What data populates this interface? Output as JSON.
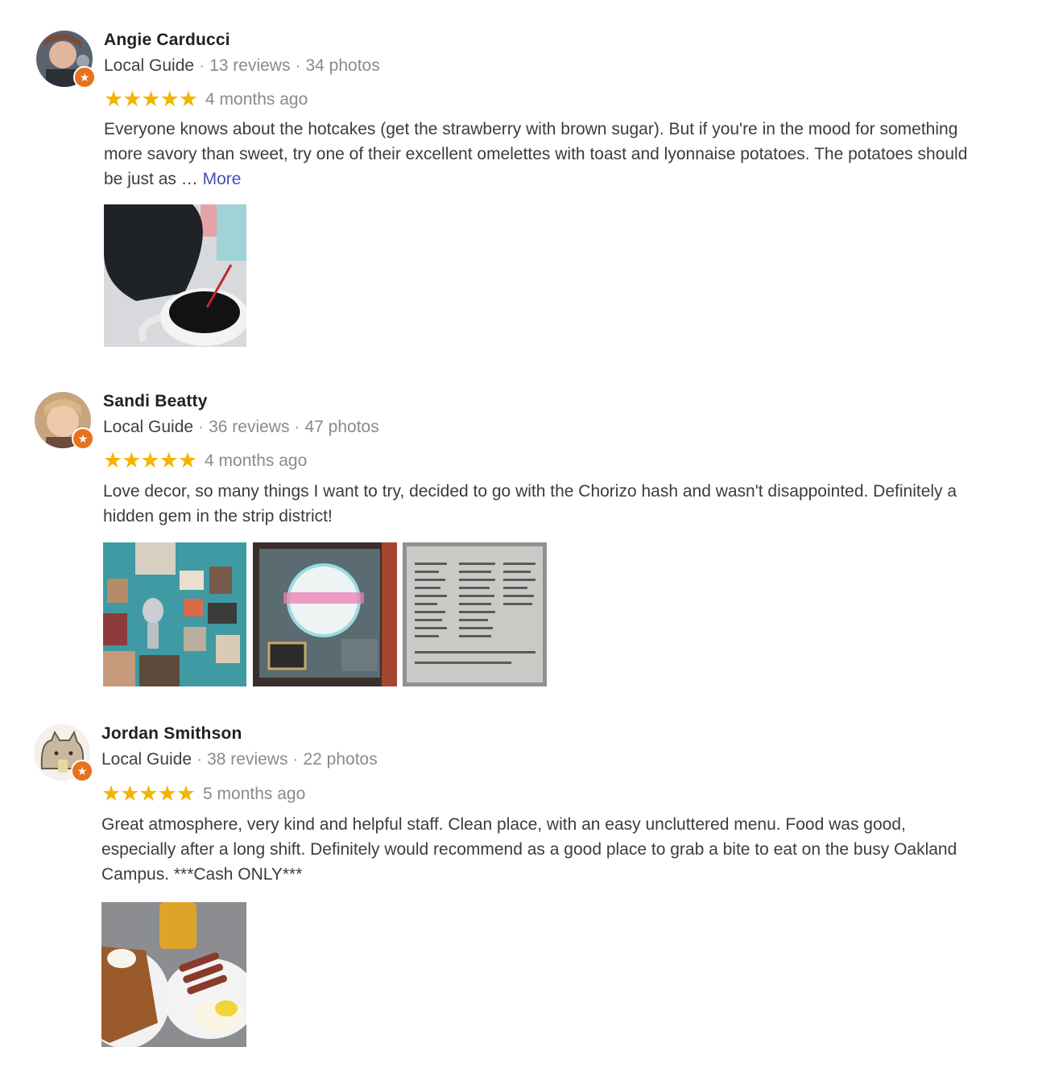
{
  "reviews": [
    {
      "name": "Angie Carducci",
      "badge": "Local Guide",
      "reviews_count": "13 reviews",
      "photos_count": "34 photos",
      "rating": 5,
      "stars": "★★★★★",
      "date": "4 months ago",
      "text": "Everyone knows about the hotcakes (get the strawberry with brown sugar). But if you're in the mood for something more savory than sweet, try one of their excellent omelettes with toast and lyonnaise potatoes. The potatoes should be just as …",
      "more_label": "More"
    },
    {
      "name": "Sandi Beatty",
      "badge": "Local Guide",
      "reviews_count": "36 reviews",
      "photos_count": "47 photos",
      "rating": 5,
      "stars": "★★★★★",
      "date": "4 months ago",
      "text": "Love decor, so many things I want to try, decided to go with the Chorizo hash and wasn't disappointed. Definitely a hidden gem in the strip district!"
    },
    {
      "name": "Jordan Smithson",
      "badge": "Local Guide",
      "reviews_count": "38 reviews",
      "photos_count": "22 photos",
      "rating": 5,
      "stars": "★★★★★",
      "date": "5 months ago",
      "text": "Great atmosphere, very kind and helpful staff. Clean place, with an easy uncluttered menu. Food was good, especially after a long shift. Definitely would recommend as a good place to grab a bite to eat on the busy Oakland Campus. ***Cash ONLY***"
    }
  ],
  "separator": "·",
  "badge_icon": "star-badge-icon",
  "colors": {
    "star": "#f4b400",
    "more_link": "#3f51b5",
    "guide_badge": "#e8711c"
  }
}
